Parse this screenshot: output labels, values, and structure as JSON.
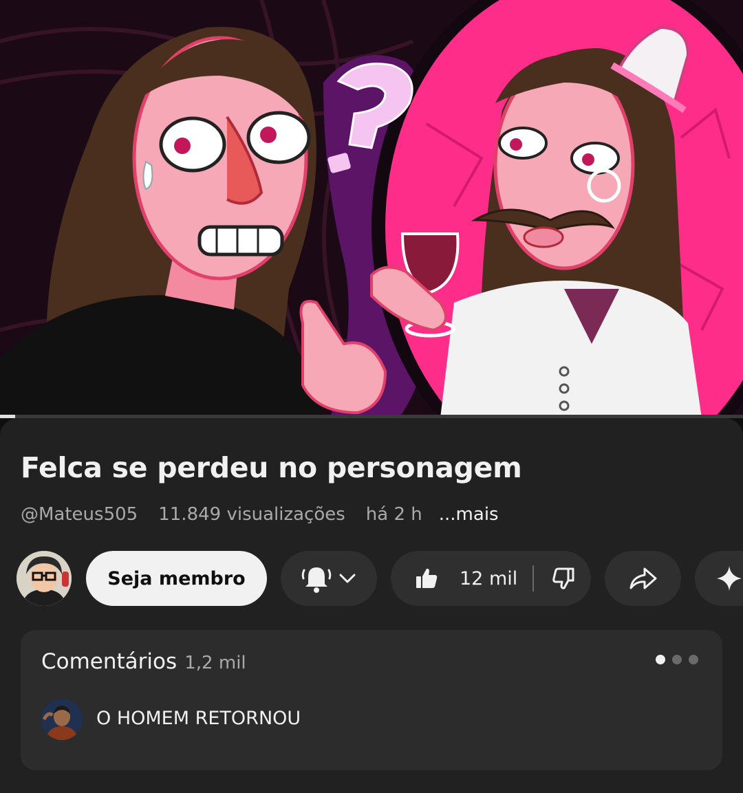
{
  "video": {
    "thumbnail_alt": "",
    "progress_fraction": 0.02
  },
  "title": "Felca se perdeu no personagem",
  "meta": {
    "channel_handle": "@Mateus505",
    "views": "11.849 visualizações",
    "age": "há 2 h",
    "more": "...mais"
  },
  "actions": {
    "join_label": "Seja membro",
    "bell_icon": "bell-icon",
    "like_count": "12 mil",
    "like_icon": "thumbs-up-icon",
    "dislike_icon": "thumbs-down-icon",
    "share_icon": "share-icon",
    "remix_icon": "sparkle-icon"
  },
  "comments": {
    "title": "Comentários",
    "count": "1,2 mil",
    "top_comment": "O HOMEM RETORNOU"
  },
  "colors": {
    "background": "#0f0f0f",
    "panel": "#212121",
    "button": "#2f2f2f",
    "card": "#2c2c2c",
    "thumbnail_pink": "#ff2d8a",
    "thumbnail_purple": "#5b1466"
  }
}
